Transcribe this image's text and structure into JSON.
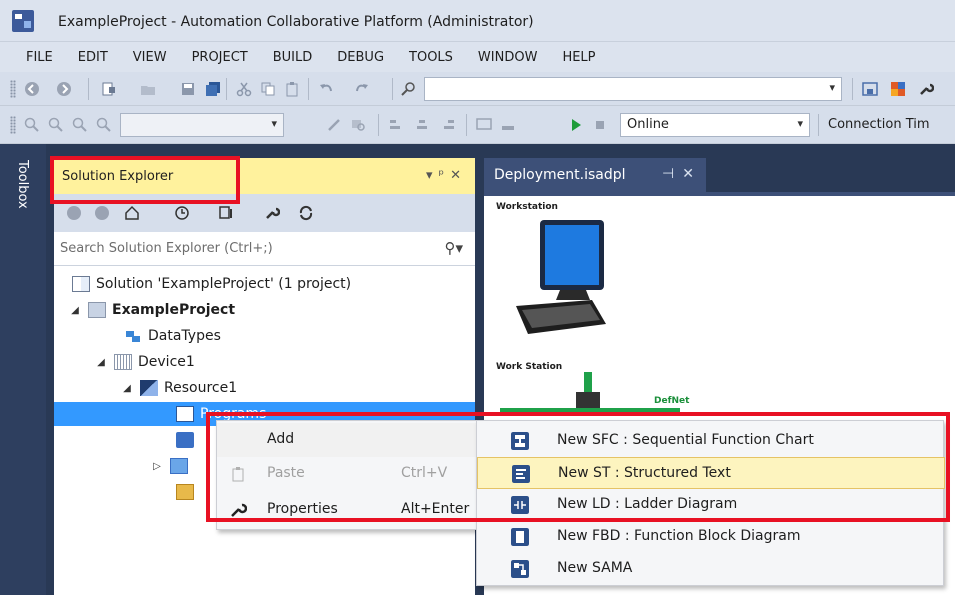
{
  "window": {
    "title": "ExampleProject - Automation Collaborative Platform (Administrator)"
  },
  "menu": [
    "FILE",
    "EDIT",
    "VIEW",
    "PROJECT",
    "BUILD",
    "DEBUG",
    "TOOLS",
    "WINDOW",
    "HELP"
  ],
  "toolbar": {
    "mode_value": "Online",
    "connection_label": "Connection Tim"
  },
  "toolbox": {
    "label": "Toolbox"
  },
  "solution_explorer": {
    "title": "Solution Explorer",
    "search_placeholder": "Search Solution Explorer (Ctrl+;)",
    "tree": {
      "solution": "Solution 'ExampleProject' (1 project)",
      "project": "ExampleProject",
      "datatypes": "DataTypes",
      "device": "Device1",
      "resource": "Resource1",
      "programs": "Programs"
    }
  },
  "document": {
    "tab_label": "Deployment.isadpl",
    "labels": {
      "workstation": "Workstation",
      "work_station": "Work Station",
      "defnet": "DefNet"
    }
  },
  "context_menu": {
    "items": [
      {
        "label": "Add",
        "shortcut": "",
        "has_submenu": true
      },
      {
        "label": "Paste",
        "shortcut": "Ctrl+V",
        "disabled": true
      },
      {
        "label": "Properties",
        "shortcut": "Alt+Enter"
      }
    ]
  },
  "add_submenu": {
    "items": [
      {
        "label": "New SFC : Sequential Function Chart"
      },
      {
        "label": "New ST : Structured Text"
      },
      {
        "label": "New LD : Ladder Diagram"
      },
      {
        "label": "New FBD : Function Block Diagram"
      },
      {
        "label": "New SAMA"
      }
    ]
  },
  "colors": {
    "highlight_box": "#e81123",
    "selection": "#3399ff",
    "panel_header": "#fff29d"
  }
}
